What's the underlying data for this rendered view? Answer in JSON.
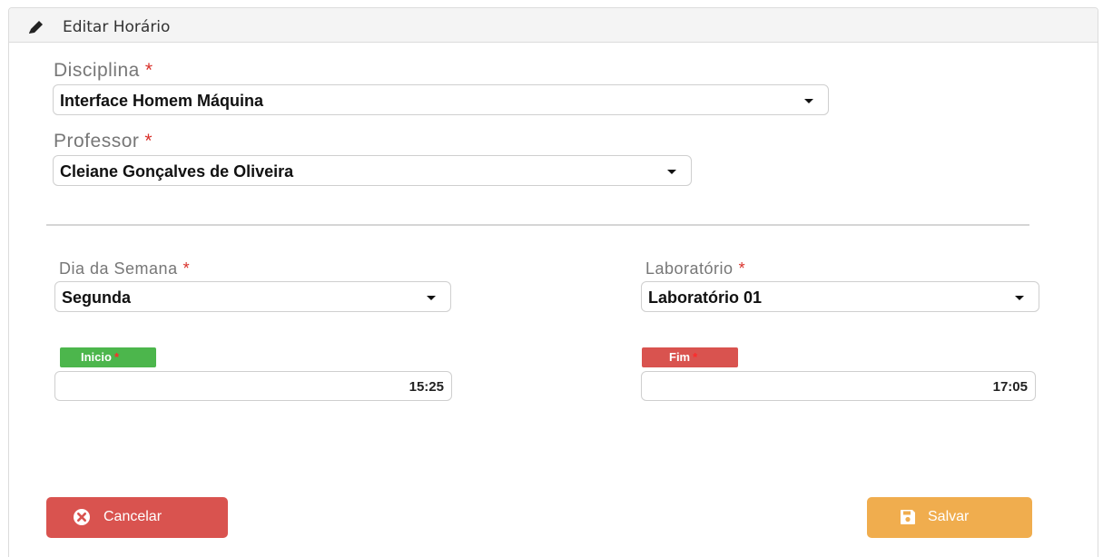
{
  "header": {
    "title": "Editar Horário",
    "icon": "pencil-icon"
  },
  "form": {
    "disciplina": {
      "label": "Disciplina",
      "required_mark": "*",
      "value": "Interface Homem Máquina"
    },
    "professor": {
      "label": "Professor",
      "required_mark": "*",
      "value": "Cleiane Gonçalves de Oliveira"
    },
    "dia_semana": {
      "label": "Dia da Semana",
      "required_mark": "*",
      "value": "Segunda"
    },
    "laboratorio": {
      "label": "Laboratório",
      "required_mark": "*",
      "value": "Laboratório 01"
    },
    "inicio": {
      "label": "Inicio",
      "required_mark": "*",
      "value": "15:25",
      "badge_color": "#4cb64c"
    },
    "fim": {
      "label": "Fim",
      "required_mark": "*",
      "value": "17:05",
      "badge_color": "#d9534f"
    }
  },
  "actions": {
    "cancel": {
      "label": "Cancelar",
      "icon": "close-circle-icon",
      "color": "#d9534f"
    },
    "save": {
      "label": "Salvar",
      "icon": "floppy-disk-icon",
      "color": "#f0ad4e"
    }
  },
  "colors": {
    "required": "#d9312b"
  }
}
